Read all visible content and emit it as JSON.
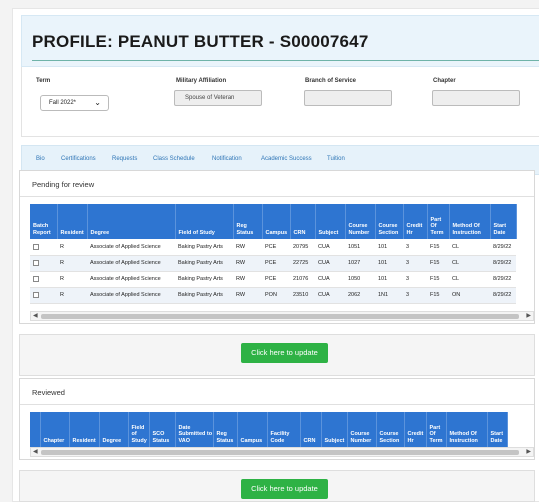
{
  "profile": {
    "title": "PROFILE: PEANUT BUTTER - S00007647"
  },
  "fields": {
    "term": {
      "label": "Term",
      "value": "Fall 2022*"
    },
    "military": {
      "label": "Military Affiliation",
      "value": "Spouse of Veteran"
    },
    "branch": {
      "label": "Branch of Service",
      "value": ""
    },
    "chapter": {
      "label": "Chapter",
      "value": ""
    }
  },
  "tabs": [
    "Bio",
    "Certifications",
    "Requests",
    "Class Schedule",
    "Notification",
    "Academic Success",
    "Tuition"
  ],
  "pending": {
    "title": "Pending for review",
    "columns": [
      "Batch Report",
      "Resident",
      "Degree",
      "Field of Study",
      "Reg Status",
      "Campus",
      "CRN",
      "Subject",
      "Course Number",
      "Course Section",
      "Credit Hr",
      "Part Of Term",
      "Method Of Instruction",
      "Start Date"
    ],
    "rows": [
      [
        "",
        "R",
        "Associate of Applied Science",
        "Baking Pastry Arts",
        "RW",
        "PCE",
        "20795",
        "CUA",
        "1051",
        "101",
        "3",
        "F15",
        "CL",
        "8/29/22"
      ],
      [
        "",
        "R",
        "Associate of Applied Science",
        "Baking Pastry Arts",
        "RW",
        "PCE",
        "22725",
        "CUA",
        "1027",
        "101",
        "3",
        "F15",
        "CL",
        "8/29/22"
      ],
      [
        "",
        "R",
        "Associate of Applied Science",
        "Baking Pastry Arts",
        "RW",
        "PCE",
        "21076",
        "CUA",
        "1050",
        "101",
        "3",
        "F15",
        "CL",
        "8/29/22"
      ],
      [
        "",
        "R",
        "Associate of Applied Science",
        "Baking Pastry Arts",
        "RW",
        "PON",
        "23510",
        "CUA",
        "2062",
        "1N1",
        "3",
        "F15",
        "ON",
        "8/29/22"
      ]
    ],
    "button": "Click here to update"
  },
  "reviewed": {
    "title": "Reviewed",
    "columns": [
      "",
      "Chapter",
      "Resident",
      "Degree",
      "Field of Study",
      "SCO Status",
      "Date Submitted to VAO",
      "Reg Status",
      "Campus",
      "Facility Code",
      "CRN",
      "Subject",
      "Course Number",
      "Course Section",
      "Credit Hr",
      "Part Of Term",
      "Method Of Instruction",
      "Start Date"
    ],
    "button": "Click here to update"
  }
}
